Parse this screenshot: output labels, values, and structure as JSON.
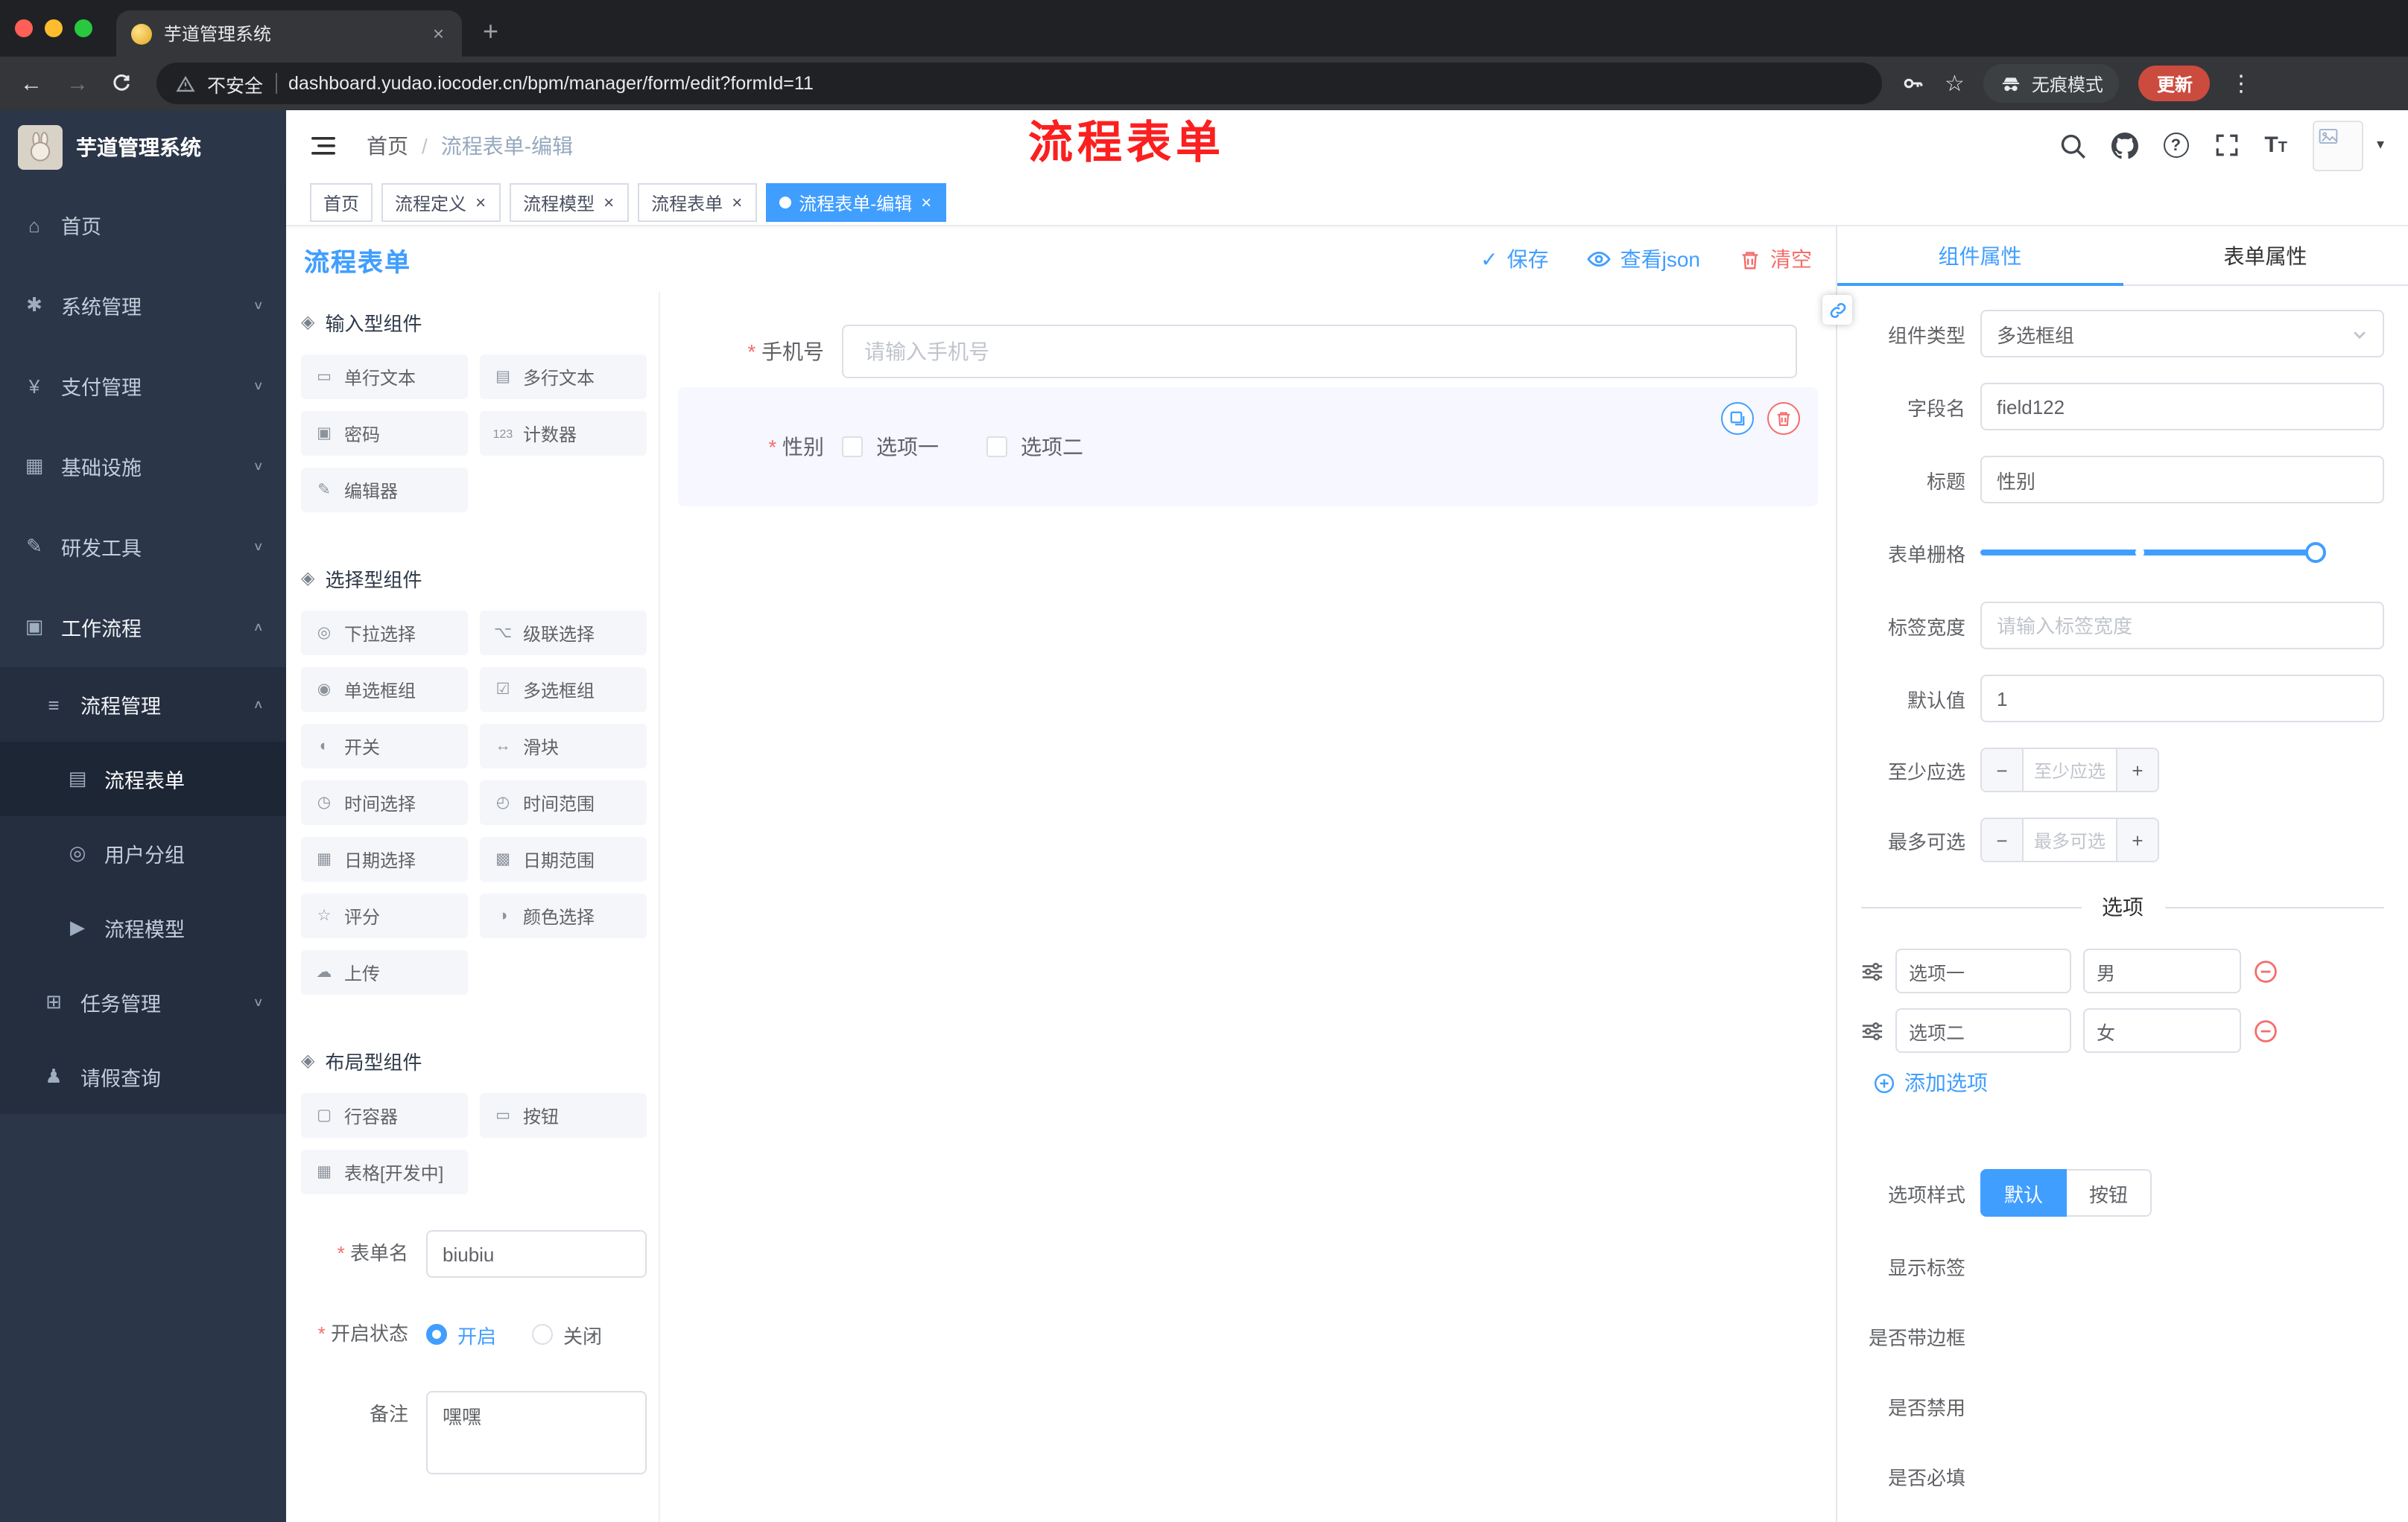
{
  "browser": {
    "tab": {
      "title": "芋道管理系统"
    },
    "toolbar": {
      "security_label": "不安全",
      "url": "dashboard.yudao.iocoder.cn/bpm/manager/form/edit?formId=11",
      "incognito_label": "无痕模式",
      "update_label": "更新"
    }
  },
  "sidebar": {
    "logo_title": "芋道管理系统",
    "items": [
      {
        "label": "首页",
        "glyph": "⌂",
        "arrow": ""
      },
      {
        "label": "系统管理",
        "glyph": "✱",
        "arrow": "∨"
      },
      {
        "label": "支付管理",
        "glyph": "¥",
        "arrow": "∨"
      },
      {
        "label": "基础设施",
        "glyph": "▦",
        "arrow": "∨"
      },
      {
        "label": "研发工具",
        "glyph": "✎",
        "arrow": "∨"
      },
      {
        "label": "工作流程",
        "glyph": "▣",
        "arrow": "∧"
      },
      {
        "label": "流程管理",
        "glyph": "≡",
        "arrow": "∧"
      },
      {
        "label": "流程表单",
        "glyph": "▤",
        "arrow": ""
      },
      {
        "label": "用户分组",
        "glyph": "◎",
        "arrow": ""
      },
      {
        "label": "流程模型",
        "glyph": "▶",
        "arrow": ""
      },
      {
        "label": "任务管理",
        "glyph": "⊞",
        "arrow": "∨"
      },
      {
        "label": "请假查询",
        "glyph": "♟",
        "arrow": ""
      }
    ]
  },
  "header": {
    "breadcrumb": {
      "home": "首页",
      "sep": "/",
      "current": "流程表单-编辑"
    },
    "annotation": "流程表单"
  },
  "tags": [
    {
      "label": "首页"
    },
    {
      "label": "流程定义"
    },
    {
      "label": "流程模型"
    },
    {
      "label": "流程表单"
    },
    {
      "label": "流程表单-编辑"
    }
  ],
  "designer": {
    "title": "流程表单",
    "actions": {
      "save": "保存",
      "view_json": "查看json",
      "clear": "清空"
    },
    "palette": {
      "sections": [
        {
          "title": "输入型组件",
          "items": [
            {
              "label": "单行文本",
              "glyph": "▭"
            },
            {
              "label": "多行文本",
              "glyph": "▤"
            },
            {
              "label": "密码",
              "glyph": "▣"
            },
            {
              "label": "计数器",
              "glyph": "123"
            },
            {
              "label": "编辑器",
              "glyph": "✎"
            }
          ]
        },
        {
          "title": "选择型组件",
          "items": [
            {
              "label": "下拉选择",
              "glyph": "◎"
            },
            {
              "label": "级联选择",
              "glyph": "⌥"
            },
            {
              "label": "单选框组",
              "glyph": "◉"
            },
            {
              "label": "多选框组",
              "glyph": "☑"
            },
            {
              "label": "开关",
              "glyph": "◐"
            },
            {
              "label": "滑块",
              "glyph": "↔"
            },
            {
              "label": "时间选择",
              "glyph": "◷"
            },
            {
              "label": "时间范围",
              "glyph": "◴"
            },
            {
              "label": "日期选择",
              "glyph": "▦"
            },
            {
              "label": "日期范围",
              "glyph": "▩"
            },
            {
              "label": "评分",
              "glyph": "☆"
            },
            {
              "label": "颜色选择",
              "glyph": "◑"
            },
            {
              "label": "上传",
              "glyph": "☁"
            }
          ]
        },
        {
          "title": "布局型组件",
          "items": [
            {
              "label": "行容器",
              "glyph": "▢"
            },
            {
              "label": "按钮",
              "glyph": "▭"
            },
            {
              "label": "表格[开发中]",
              "glyph": "▦"
            }
          ]
        }
      ]
    },
    "meta": {
      "form_name": {
        "label": "表单名",
        "value": "biubiu"
      },
      "status": {
        "label": "开启状态",
        "options": [
          "开启",
          "关闭"
        ],
        "selected": "开启"
      },
      "remark": {
        "label": "备注",
        "value": "嘿嘿"
      }
    },
    "canvas": {
      "phone": {
        "label": "手机号",
        "placeholder": "请输入手机号"
      },
      "gender": {
        "label": "性别",
        "options": [
          "选项一",
          "选项二"
        ]
      }
    }
  },
  "panel": {
    "tabs": {
      "component": "组件属性",
      "form": "表单属性"
    },
    "fields": {
      "component_type": {
        "label": "组件类型",
        "value": "多选框组"
      },
      "field_name": {
        "label": "字段名",
        "value": "field122"
      },
      "title": {
        "label": "标题",
        "value": "性别"
      },
      "grid": {
        "label": "表单栅格"
      },
      "label_width": {
        "label": "标签宽度",
        "placeholder": "请输入标签宽度"
      },
      "default_value": {
        "label": "默认值",
        "value": "1"
      },
      "min_select": {
        "label": "至少应选",
        "placeholder": "至少应选"
      },
      "max_select": {
        "label": "最多可选",
        "placeholder": "最多可选"
      }
    },
    "options": {
      "divider": "选项",
      "rows": [
        {
          "name": "选项一",
          "value": "男"
        },
        {
          "name": "选项二",
          "value": "女"
        }
      ],
      "add_label": "添加选项"
    },
    "style": {
      "label": "选项样式",
      "options": [
        "默认",
        "按钮"
      ],
      "selected": "默认"
    },
    "switches": [
      {
        "label": "显示标签",
        "on": true
      },
      {
        "label": "是否带边框",
        "on": false
      },
      {
        "label": "是否禁用",
        "on": false
      },
      {
        "label": "是否必填",
        "on": true
      }
    ]
  },
  "colors": {
    "accent": "#409eff",
    "danger": "#f56c6c",
    "sidebar_bg": "#2b3648",
    "annotation": "#fb1f1f",
    "update_pill": "#cc4b3f"
  }
}
